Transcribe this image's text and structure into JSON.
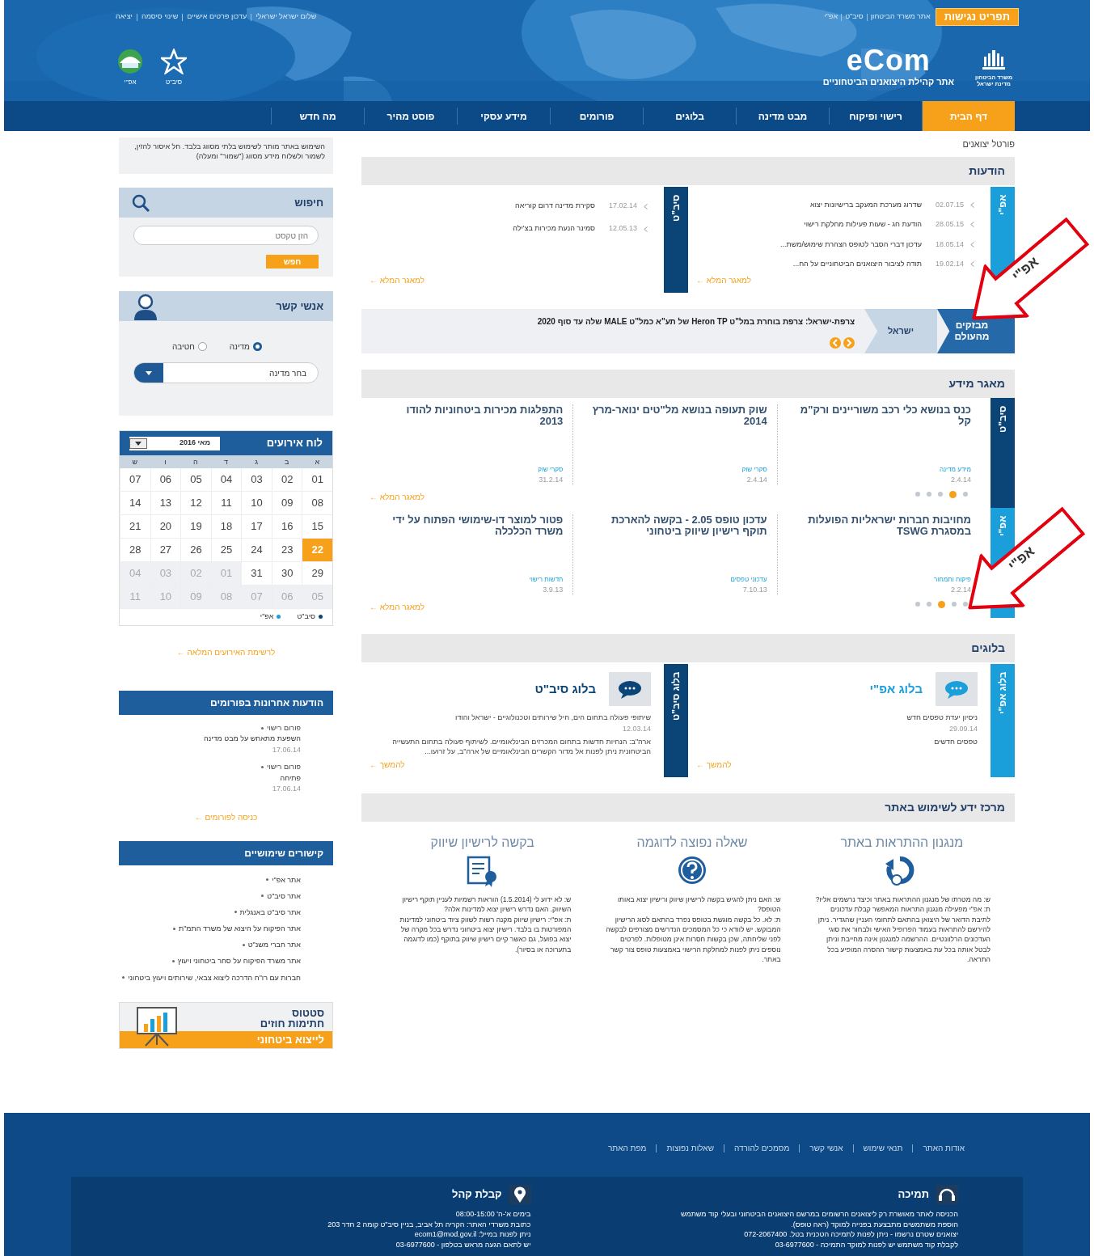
{
  "header": {
    "accessibility": "תפריט נגישות",
    "links": [
      "אתר משרד הביטחון",
      "סיב\"ט",
      "אפ\"י"
    ],
    "user_links": [
      "שלום ישראל ישראלי",
      "עדכון פרטים אישיים",
      "שינוי סיסמה",
      "יציאה"
    ],
    "ministry": [
      "משרד הביטחון",
      "מדינת ישראל"
    ],
    "logo": "eCom",
    "tagline": "אתר קהילת היצואנים הביטחוניים",
    "units": [
      {
        "label": "סיב\"ט",
        "kind": "star"
      },
      {
        "label": "אפ\"י",
        "kind": "dome"
      }
    ]
  },
  "nav": [
    {
      "label": "דף הבית",
      "selected": true
    },
    {
      "label": "רישוי ופיקוח",
      "selected": false
    },
    {
      "label": "מבט מדינה",
      "selected": false
    },
    {
      "label": "בלוגים",
      "selected": false
    },
    {
      "label": "פורומים",
      "selected": false
    },
    {
      "label": "מידע עסקי",
      "selected": false
    },
    {
      "label": "פוסט מהיר",
      "selected": false
    },
    {
      "label": "מה חדש",
      "selected": false
    }
  ],
  "breadcrumb": "פורטל יצואנים",
  "announcements": {
    "title": "הודעות",
    "groups": [
      {
        "tab": "אפ\"י",
        "color": "#1a9fdb",
        "more": "למאגר המלא ←",
        "items": [
          {
            "date": "02.07.15",
            "text": "שדרוג מערכת המעקב ברישיונות יצוא"
          },
          {
            "date": "28.05.15",
            "text": "הודעת חג - שעות פעילות מחלקת רישוי"
          },
          {
            "date": "18.05.14",
            "text": "עדכון דברי הסבר לטופס הצהרת שימוש/משת..."
          },
          {
            "date": "19.02.14",
            "text": "תודה לציבור היצואנים הביטחוניים על הח..."
          }
        ]
      },
      {
        "tab": "סיב\"ט",
        "color": "#0b4477",
        "more": "למאגר המלא ←",
        "items": [
          {
            "date": "17.02.14",
            "text": "סקירת מדינה דרום קוריאה"
          },
          {
            "date": "12.05.13",
            "text": "סמינר הנעת מכירות בצ'ילה"
          }
        ]
      }
    ]
  },
  "ticker": {
    "badge": "מבזקים מהעולם",
    "region": "ישראל",
    "text": "צרפת-ישראל: צרפת בוחרת במל\"ט Heron TP של תע\"א כמל\"ט MALE שלה עד סוף 2020"
  },
  "knowledge": {
    "title": "מאגר מידע",
    "groups": [
      {
        "tab": "סיב\"ט",
        "color": "#0b4477",
        "more": "למאגר המלא ←",
        "cards": [
          {
            "title": "כנס בנושא כלי רכב משוריינים ורק\"מ קל",
            "category": "מידע מדינה",
            "date": "2.4.14"
          },
          {
            "title": "שוק תעופה בנושא מל\"טים ינואר-מרץ 2014",
            "category": "סקרי שוק",
            "date": "2.4.14"
          },
          {
            "title": "התפלגות מכירות ביטחוניות להודו 2013",
            "category": "סקרי שוק",
            "date": "31.2.14"
          }
        ],
        "dots": [
          {
            "selected": false
          },
          {
            "selected": true
          },
          {
            "selected": false
          },
          {
            "selected": false
          },
          {
            "selected": false
          }
        ]
      },
      {
        "tab": "אפ\"י",
        "color": "#1a9fdb",
        "more": "למאגר המלא ←",
        "cards": [
          {
            "title": "מחויבות חברות ישראליות הפועלות במסגרת TSWG",
            "category": "פיקוח ותמחור",
            "date": "2.2.14"
          },
          {
            "title": "עדכון טופס 2.05 - בקשה להארכת תוקף רישיון שיווק ביטחוני",
            "category": "עדכוני טפסים",
            "date": "7.10.13"
          },
          {
            "title": "פטור למוצר דו-שימושי הפתוח על ידי משרד הכלכלה",
            "category": "חדשות רישוי",
            "date": "3.9.13"
          }
        ],
        "dots": [
          {
            "selected": false
          },
          {
            "selected": false
          },
          {
            "selected": true
          },
          {
            "selected": false
          },
          {
            "selected": false
          }
        ]
      }
    ]
  },
  "blogs": {
    "title": "בלוגים",
    "items": [
      {
        "tab": "בלוג אפ\"י",
        "color": "#1a9fdb",
        "title": "בלוג אפ\"י",
        "subtitle": "ניסיון יעדת טפסים חדש",
        "date": "29.09.14",
        "text": "טפסים חדשים",
        "more": "להמשך ←"
      },
      {
        "tab": "בלוג סיב\"ט",
        "color": "#0b4477",
        "title": "בלוג סיב\"ט",
        "subtitle": "שיתופי פעולה בתחום הים, חיל שירותים וטכנולוגיים - ישראל והודו",
        "date": "12.03.14",
        "text": "ארה\"ב: הנחיות חדשות בתחום המכרזים הבינלאומיים. לשיתוף פעולה בתחום התעשייה הביטחונית ניתן לפנות אל מדור הקשרים הבינלאומיים של ארה\"ב, על זרועו...",
        "more": "להמשך ←"
      }
    ]
  },
  "help": {
    "title": "מרכז ידע לשימוש באתר",
    "items": [
      {
        "kind": "refresh",
        "title": "מנגנון ההתראות באתר",
        "question": "ש: מה מטרתו של מנגנון ההתראות באתר וכיצד נרשמים אליו?",
        "answer": "ת: אפ\"י מפעילה מנגנון התראות המאפשר קבלת עדכונים לתיבת הדואר של היצואן בהתאם לתחומי העניין שהגדיר. ניתן להירשם להתראות בעמוד הפרופיל האישי ולבחור את סוגי העדכונים הרלוונטיים. ההרשמה למנגנון אינה מחייבת וניתן לבטל אותה בכל עת באמצעות קישור ההסרה המופיע בכל התראה."
      },
      {
        "kind": "question",
        "title": "שאלה נפוצה לדוגמה",
        "question": "ש: האם ניתן להגיש בקשה לרישיון שיווק ורישיון יצוא באותו הטופס?",
        "answer": "ת: לא. כל בקשה מוגשת בטופס נפרד בהתאם לסוג הרישיון המבוקש. יש לוודא כי כל המסמכים הנדרשים מצורפים לבקשה לפני שליחתה, שכן בקשות חסרות אינן מטופלות. לפרטים נוספים ניתן לפנות למחלקת הרישוי באמצעות טופס צור קשר באתר."
      },
      {
        "kind": "certificate",
        "title": "בקשה לרישיון שיווק",
        "question": "ש: לא ידוע לי (1.5.2014) הוראות רשמיות לעניין תוקף רישיון השיווק. האם נדרש רישיון יצוא למדינות אלה?",
        "answer": "ת: אפ\"י: רישיון שיווק מקנה רשות לשווק ציוד ביטחוני למדינות המפורטות בו בלבד. רישיון יצוא ביטחוני נדרש בכל מקרה של יצוא בפועל, גם כאשר קיים רישיון שיווק בתוקף (כמו לדוגמה בתערוכה או בסיור)."
      }
    ]
  },
  "sidebar": {
    "notice": "השימוש באתר מותר לשימוש בלתי מסווג בלבד. חל איסור להזין, לשמור ולשלוח מידע מסווג (\"שמור\" ומעלה)",
    "search": {
      "title": "חיפוש",
      "placeholder": "הזן טקסט",
      "button": "חפש"
    },
    "contacts": {
      "title": "אנשי קשר",
      "options": [
        {
          "label": "מדינה",
          "selected": true
        },
        {
          "label": "חטיבה",
          "selected": false
        }
      ],
      "select": "בחר מדינה"
    },
    "calendar": {
      "title": "לוח אירועים",
      "month": "מאי 2016",
      "weekdays": [
        "א",
        "ב",
        "ג",
        "ד",
        "ה",
        "ו",
        "ש"
      ],
      "weeks": [
        [
          {
            "d": "01",
            "muted": false,
            "selected": false
          },
          {
            "d": "02",
            "muted": false,
            "selected": false
          },
          {
            "d": "03",
            "muted": false,
            "selected": false
          },
          {
            "d": "04",
            "muted": false,
            "selected": false
          },
          {
            "d": "05",
            "muted": false,
            "selected": false
          },
          {
            "d": "06",
            "muted": false,
            "selected": false
          },
          {
            "d": "07",
            "muted": false,
            "selected": false
          }
        ],
        [
          {
            "d": "08",
            "muted": false,
            "selected": false
          },
          {
            "d": "09",
            "muted": false,
            "selected": false
          },
          {
            "d": "10",
            "muted": false,
            "selected": false
          },
          {
            "d": "11",
            "muted": false,
            "selected": false
          },
          {
            "d": "12",
            "muted": false,
            "selected": false
          },
          {
            "d": "13",
            "muted": false,
            "selected": false
          },
          {
            "d": "14",
            "muted": false,
            "selected": false
          }
        ],
        [
          {
            "d": "15",
            "muted": false,
            "selected": false
          },
          {
            "d": "16",
            "muted": false,
            "selected": false
          },
          {
            "d": "17",
            "muted": false,
            "selected": false
          },
          {
            "d": "18",
            "muted": false,
            "selected": false
          },
          {
            "d": "19",
            "muted": false,
            "selected": false
          },
          {
            "d": "20",
            "muted": false,
            "selected": false
          },
          {
            "d": "21",
            "muted": false,
            "selected": false
          }
        ],
        [
          {
            "d": "22",
            "muted": false,
            "selected": true
          },
          {
            "d": "23",
            "muted": false,
            "selected": false
          },
          {
            "d": "24",
            "muted": false,
            "selected": false
          },
          {
            "d": "25",
            "muted": false,
            "selected": false
          },
          {
            "d": "26",
            "muted": false,
            "selected": false
          },
          {
            "d": "27",
            "muted": false,
            "selected": false
          },
          {
            "d": "28",
            "muted": false,
            "selected": false
          }
        ],
        [
          {
            "d": "29",
            "muted": false,
            "selected": false
          },
          {
            "d": "30",
            "muted": false,
            "selected": false
          },
          {
            "d": "31",
            "muted": false,
            "selected": false
          },
          {
            "d": "01",
            "muted": true,
            "selected": false
          },
          {
            "d": "02",
            "muted": true,
            "selected": false
          },
          {
            "d": "03",
            "muted": true,
            "selected": false
          },
          {
            "d": "04",
            "muted": true,
            "selected": false
          }
        ],
        [
          {
            "d": "05",
            "muted": true,
            "selected": false
          },
          {
            "d": "06",
            "muted": true,
            "selected": false
          },
          {
            "d": "07",
            "muted": true,
            "selected": false
          },
          {
            "d": "08",
            "muted": true,
            "selected": false
          },
          {
            "d": "09",
            "muted": true,
            "selected": false
          },
          {
            "d": "10",
            "muted": true,
            "selected": false
          },
          {
            "d": "11",
            "muted": true,
            "selected": false
          }
        ]
      ],
      "legend": [
        {
          "label": "סיב\"ט",
          "color": "#0b4477"
        },
        {
          "label": "אפ\"י",
          "color": "#1a9fdb"
        }
      ],
      "more": "לרשימת האירועים המלאה ←"
    },
    "forums": {
      "title": "הודעות אחרונות בפורומים",
      "items": [
        {
          "forum": "פורום רישוי",
          "title": "השפעת מתאחש על מבט מדינה",
          "date": "17.06.14"
        },
        {
          "forum": "פורום רישוי",
          "title": "פתיחה",
          "date": "17.06.14"
        }
      ],
      "more": "כניסה לפורומים ←"
    },
    "links": {
      "title": "קישורים שימושיים",
      "items": [
        "אתר אפ\"י",
        "אתר סיב\"ט",
        "אתר סיב\"ט באנגלית",
        "אתר הפיקוח על היצוא של משרד התמ\"ת",
        "אתר חברי משנ\"ט",
        "אתר משרד הפיקוח על סחר ביטחוני ויעוץ",
        "חברות עם רו\"ח הדרכה ליצוא צבאי, שירותים ויעוץ ביטחוני"
      ]
    },
    "banner": [
      "סטטוס",
      "חתימות חוזים",
      "לייצוא ביטחוני"
    ]
  },
  "footer": {
    "links": [
      "אודות האתר",
      "תנאי שימוש",
      "אנשי קשר",
      "מסמכים להורדה",
      "שאלות נפוצות",
      "מפת האתר"
    ],
    "support": {
      "title": "תמיכה",
      "lines": [
        "הכניסה לאתר מאושרת רק ליצואנים הרשומים במרשם היצואנים הביטחוני ובעלי קוד משתמש",
        "הוספת משתמשים מתבצעת בפנייה למוקד (ראה טופס).",
        "יצואנים שטרם נרשמו - ניתן לפנות לתמיכה הטכנית בטל. 072-2067400",
        "לקבלת קוד משתמש יש לפנות למוקד התמיכה - 03-6977600"
      ]
    },
    "reception": {
      "title": "קבלת קהל",
      "lines": [
        "בימים א'-ה' 08:00-15:00",
        "כתובת משרדי האתר: הקריה תל אביב, בניין סיב\"ט קומה 2 חדר 203",
        "ניתן לפנות במייל: ecom1@mod.gov.il",
        "יש לתאם הגעה מראש בטלפון - 03-6977600"
      ]
    }
  },
  "annotations": [
    {
      "text": "אפ\"י"
    },
    {
      "text": "אפ\"י"
    }
  ]
}
